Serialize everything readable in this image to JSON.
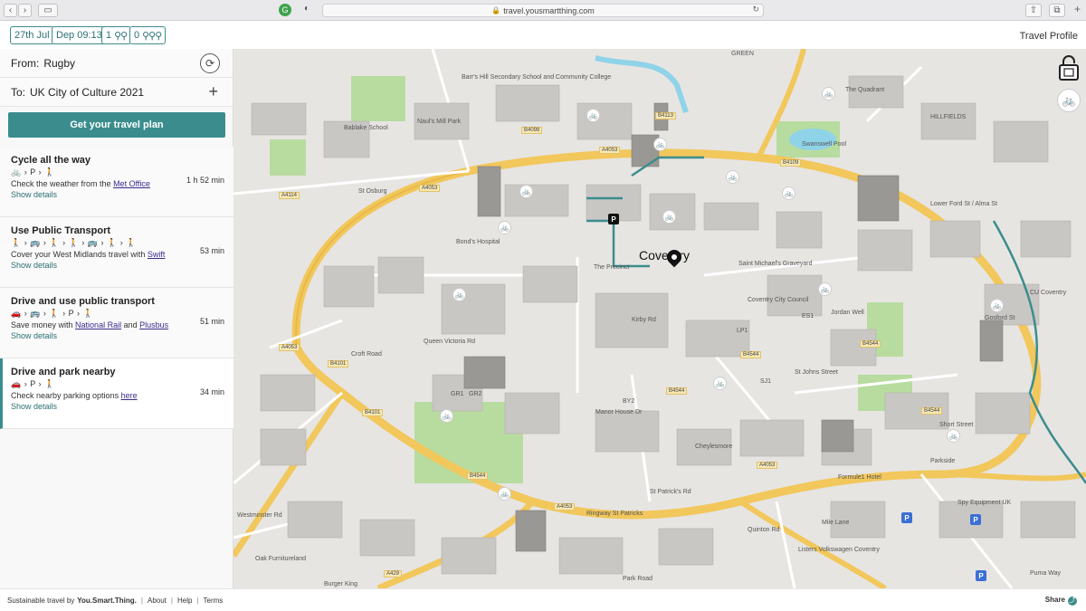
{
  "browser": {
    "url": "travel.yousmartthing.com"
  },
  "topbar": {
    "date": "27th Jul",
    "depart": "Dep 09:13",
    "adults": "1",
    "children": "0",
    "profile": "Travel Profile"
  },
  "journey": {
    "from_label": "From:",
    "from_value": "Rugby",
    "to_label": "To:",
    "to_value": "UK City of Culture 2021",
    "plan_button": "Get your travel plan"
  },
  "options": [
    {
      "title": "Cycle all the way",
      "modes": "🚲 › P › 🚶",
      "desc_prefix": "Check the weather from the ",
      "link1": "Met Office",
      "link_join": "",
      "link2": "",
      "details": "Show details",
      "duration": "1 h 52 min"
    },
    {
      "title": "Use Public Transport",
      "modes": "🚶 › 🚌 › 🚶 › 🚶 › 🚌 › 🚶 › 🚶",
      "desc_prefix": "Cover your West Midlands travel with ",
      "link1": "Swift",
      "link_join": "",
      "link2": "",
      "details": "Show details",
      "duration": "53 min"
    },
    {
      "title": "Drive and use public transport",
      "modes": "🚗 › 🚌 › 🚶 › P › 🚶",
      "desc_prefix": "Save money with ",
      "link1": "National Rail",
      "link_join": " and ",
      "link2": "Plusbus",
      "details": "Show details",
      "duration": "51 min"
    },
    {
      "title": "Drive and park nearby",
      "modes": "🚗 › P › 🚶",
      "desc_prefix": "Check nearby parking options ",
      "link1": "here",
      "link_join": "",
      "link2": "",
      "details": "Show details",
      "duration": "34 min"
    }
  ],
  "map": {
    "city": "Coventry",
    "labels": {
      "l1": "Barr's Hill Secondary School and Community College",
      "l2": "Naul's Mill Park",
      "l3": "Bablake School",
      "l4": "St Osburg",
      "l5": "Bond's Hospital",
      "l6": "The Precinct",
      "l7": "Saint Michael's Graveyard",
      "l8": "Coventry City Council",
      "l9": "Swanswell Pool",
      "l10": "HILLFIELDS",
      "l11": "Lower Ford St / Alma St",
      "l12": "CU Coventry",
      "l13": "St Johns Street",
      "l14": "Parkside",
      "l15": "Formule1 Hotel",
      "l16": "Spy Equipment UK",
      "l17": "Listers Volkswagen Coventry",
      "l18": "St Patrick's Rd",
      "l19": "Ringway St Patricks",
      "l20": "Oak Furnitureland",
      "l21": "Burger King",
      "l22": "Westminster Rd",
      "l23": "Park Road",
      "l24": "Quinton Rd",
      "l25": "Croft Road",
      "l26": "Queen Victoria Rd",
      "l27": "Short Street",
      "l28": "Mile Lane",
      "l29": "Puma Way",
      "l30": "Cheylesmore",
      "l31": "Manor House Dr",
      "l32": "Kirby Rd",
      "l33": "Jordan Well",
      "l34": "Gosford St",
      "l35": "The Quadrant",
      "l36": "GREEN"
    },
    "roads": [
      "A4053",
      "B4098",
      "B4113",
      "B4109",
      "A4114",
      "B4101",
      "B4544",
      "A429",
      "A4053",
      "B4544",
      "B4544",
      "B4544",
      "A4053",
      "A4053",
      "B4544",
      "A4053",
      "B4101"
    ],
    "stops": [
      "GR1",
      "GR2",
      "BY2",
      "ES1",
      "LP1",
      "SJ1"
    ]
  },
  "footer": {
    "prefix": "Sustainable travel by",
    "brand": "You.Smart.Thing.",
    "about": "About",
    "help": "Help",
    "terms": "Terms",
    "share": "Share"
  },
  "colors": {
    "accent": "#3b8d8d",
    "link": "#3b2b8d",
    "map_bg": "#e7e5e2",
    "road_major": "#f2c75b",
    "park": "#b8dca0",
    "water": "#8fd3e8",
    "route": "#3b8d8d"
  },
  "icons": [
    "swap-icon",
    "plus-icon",
    "bike-icon",
    "parking-icon",
    "walk-icon",
    "bus-icon",
    "car-icon",
    "lock-icon",
    "location-pin-icon",
    "share-icon"
  ]
}
